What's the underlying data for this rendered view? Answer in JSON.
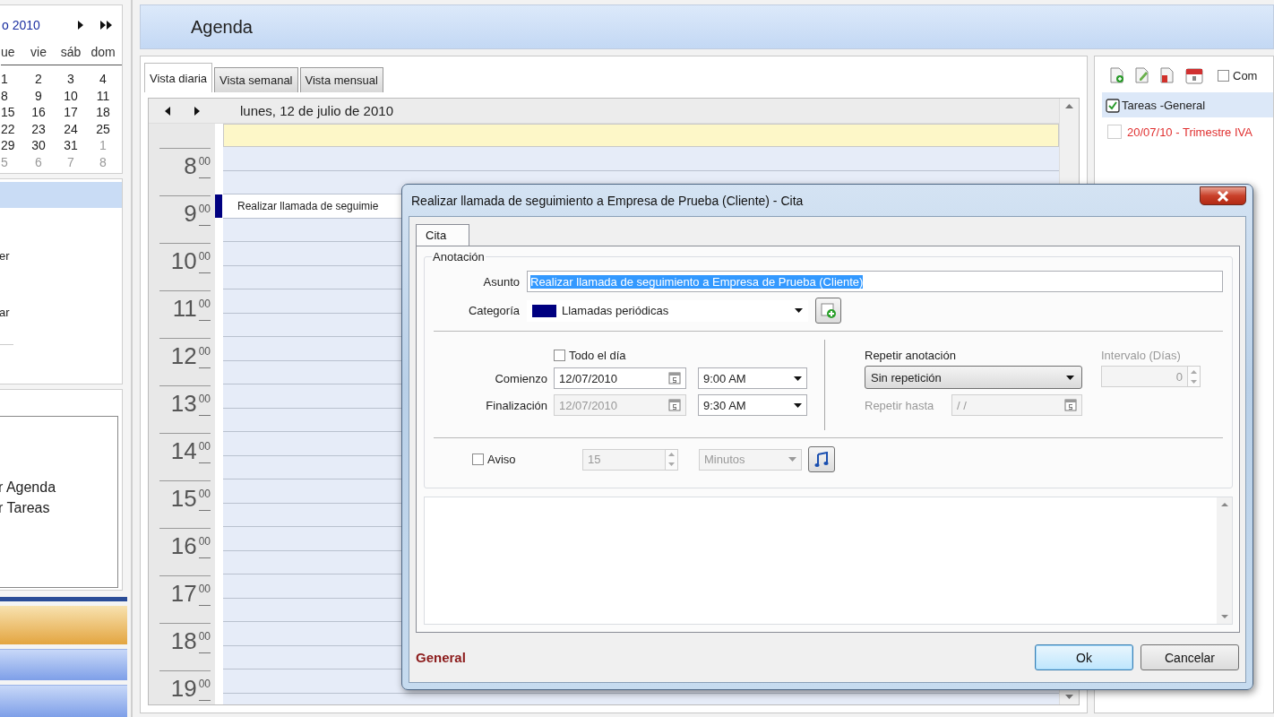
{
  "sidebar": {
    "calendar": {
      "title": "o 2010",
      "weekdays": [
        "ue",
        "vie",
        "sáb",
        "dom"
      ],
      "weeks": [
        [
          {
            "day": "1",
            "muted": false
          },
          {
            "day": "2",
            "muted": false
          },
          {
            "day": "3",
            "muted": false
          },
          {
            "day": "4",
            "muted": false
          }
        ],
        [
          {
            "day": "8",
            "muted": false
          },
          {
            "day": "9",
            "muted": false
          },
          {
            "day": "10",
            "muted": false
          },
          {
            "day": "11",
            "muted": false
          }
        ],
        [
          {
            "day": "15",
            "muted": false
          },
          {
            "day": "16",
            "muted": false
          },
          {
            "day": "17",
            "muted": false
          },
          {
            "day": "18",
            "muted": false
          }
        ],
        [
          {
            "day": "22",
            "muted": false
          },
          {
            "day": "23",
            "muted": false
          },
          {
            "day": "24",
            "muted": false
          },
          {
            "day": "25",
            "muted": false
          }
        ],
        [
          {
            "day": "29",
            "muted": false
          },
          {
            "day": "30",
            "muted": false
          },
          {
            "day": "31",
            "muted": false
          },
          {
            "day": "1",
            "muted": true
          }
        ],
        [
          {
            "day": "5",
            "muted": true
          },
          {
            "day": "6",
            "muted": true
          },
          {
            "day": "7",
            "muted": true
          },
          {
            "day": "8",
            "muted": true
          }
        ]
      ]
    },
    "nav_panel": {
      "items": [
        "er",
        "ar"
      ]
    },
    "views_panel": {
      "items": [
        "r Agenda",
        "r Tareas"
      ]
    }
  },
  "header": {
    "title": "Agenda"
  },
  "agenda": {
    "tabs": [
      {
        "label": "Vista diaria",
        "selected": true
      },
      {
        "label": "Vista semanal",
        "selected": false
      },
      {
        "label": "Vista mensual",
        "selected": false
      }
    ],
    "date": "lunes, 12 de julio de 2010",
    "hours": [
      {
        "hour": "8",
        "minutes": "00"
      },
      {
        "hour": "9",
        "minutes": "00",
        "event": {
          "text": "Realizar llamada de seguimie",
          "color": "#000080"
        }
      },
      {
        "hour": "10",
        "minutes": "00"
      },
      {
        "hour": "11",
        "minutes": "00"
      },
      {
        "hour": "12",
        "minutes": "00"
      },
      {
        "hour": "13",
        "minutes": "00"
      },
      {
        "hour": "14",
        "minutes": "00"
      },
      {
        "hour": "15",
        "minutes": "00"
      },
      {
        "hour": "16",
        "minutes": "00"
      },
      {
        "hour": "17",
        "minutes": "00"
      },
      {
        "hour": "18",
        "minutes": "00"
      },
      {
        "hour": "19",
        "minutes": "00"
      }
    ]
  },
  "tasks": {
    "filter": {
      "label": "Com",
      "checked": false
    },
    "group": "Tareas -General",
    "items": [
      {
        "text": "20/07/10 - Trimestre IVA",
        "done": false,
        "overdue": true
      }
    ]
  },
  "dialog": {
    "title": "Realizar llamada de seguimiento a Empresa de Prueba (Cliente) - Cita",
    "tabs": [
      {
        "label": "Cita",
        "selected": true
      }
    ],
    "group": "Anotación",
    "subject": {
      "label": "Asunto",
      "value": "Realizar llamada de seguimiento a Empresa de Prueba (Cliente)"
    },
    "category": {
      "label": "Categoría",
      "value": "Llamadas periódicas",
      "color": "#000080"
    },
    "all_day": {
      "label": "Todo el día",
      "checked": false
    },
    "start": {
      "label": "Comienzo",
      "date": "12/07/2010",
      "time": "9:00 AM",
      "date_disabled": false
    },
    "end": {
      "label": "Finalización",
      "date": "12/07/2010",
      "time": "9:30 AM",
      "date_disabled": true
    },
    "repeat": {
      "label": "Repetir anotación",
      "value": "Sin repetición",
      "until_label": "Repetir hasta",
      "until_value": "/ /",
      "interval_label": "Intervalo (Días)",
      "interval_value": "0",
      "disabled": true
    },
    "reminder": {
      "label": "Aviso",
      "checked": false,
      "amount": "15",
      "unit": "Minutos"
    },
    "footer_category": "General",
    "buttons": [
      {
        "label": "Ok",
        "default": true
      },
      {
        "label": "Cancelar",
        "default": false
      }
    ]
  }
}
